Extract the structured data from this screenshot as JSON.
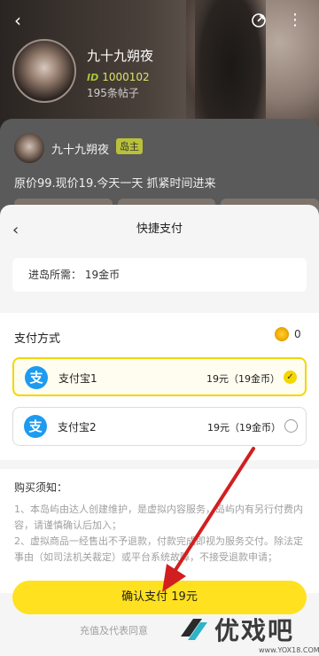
{
  "header": {
    "back_icon": "chevron-left-icon",
    "share_icon": "share-icon",
    "more_icon": "more-vertical-icon"
  },
  "profile": {
    "name": "九十九朔夜",
    "id_tag": "ID",
    "id_value": "1000102",
    "posts": "195条帖子"
  },
  "post": {
    "author": "九十九朔夜",
    "badge": "岛主",
    "text": "原价99.现价19.今天一天 抓紧时间进来"
  },
  "sheet": {
    "title": "快捷支付",
    "price_label": "进岛所需：  19金币",
    "pay_method_label": "支付方式",
    "coin_balance": "0",
    "options": [
      {
        "name": "支付宝1",
        "price": "19元（19金币）",
        "selected": true
      },
      {
        "name": "支付宝2",
        "price": "19元（19金币）",
        "selected": false
      }
    ],
    "notes_title": "购买须知：",
    "notes": [
      "1、本岛屿由达人创建维护，是虚拟内容服务，岛屿内有另行付费内容，请谨慎确认后加入；",
      "2、虚拟商品一经售出不予退款，付款完成即视为服务交付。除法定事由（如司法机关裁定）或平台系统故障，不接受退款申请；"
    ],
    "confirm_label": "确认支付 19元",
    "agree_text": "充值及代表同意"
  },
  "watermark": {
    "text": "优戏吧",
    "url": "www.YOX18.COM"
  },
  "colors": {
    "accent": "#ffe120",
    "alipay": "#1d9bf0",
    "arrow": "#d11f1f"
  }
}
